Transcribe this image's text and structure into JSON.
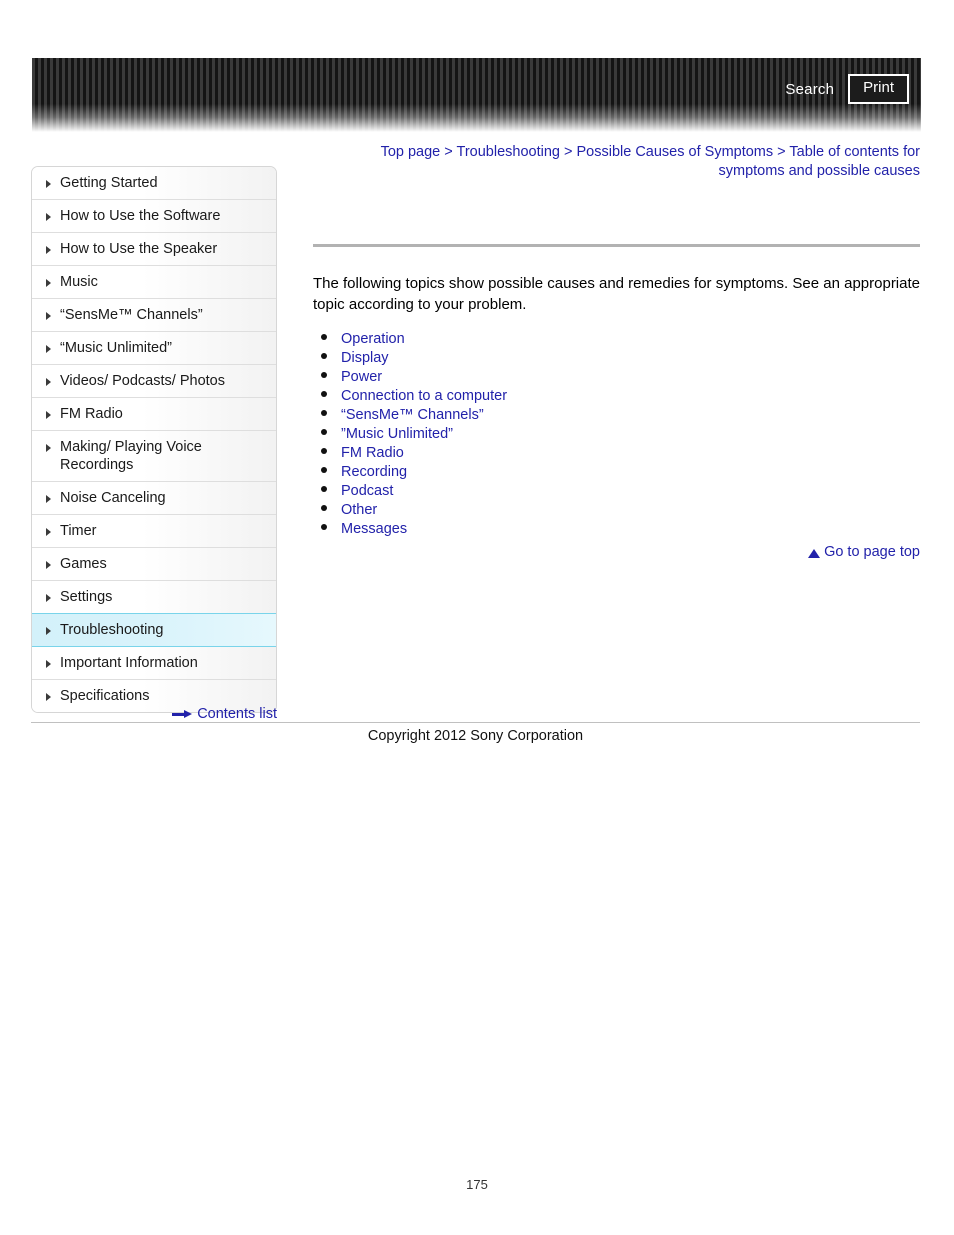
{
  "header": {
    "search_label": "Search",
    "print_label": "Print"
  },
  "breadcrumb": {
    "items": [
      "Top page",
      "Troubleshooting",
      "Possible Causes of Symptoms",
      "Table of contents for symptoms and possible causes"
    ],
    "separator": ">",
    "line1": "Top page > Troubleshooting > Possible Causes of Symptoms > Table of contents for symptoms",
    "line2": "and possible causes"
  },
  "sidebar": {
    "items": [
      {
        "label": "Getting Started",
        "active": false
      },
      {
        "label": "How to Use the Software",
        "active": false
      },
      {
        "label": "How to Use the Speaker",
        "active": false
      },
      {
        "label": "Music",
        "active": false
      },
      {
        "label": "“SensMe™ Channels”",
        "active": false
      },
      {
        "label": "“Music Unlimited”",
        "active": false
      },
      {
        "label": "Videos/ Podcasts/ Photos",
        "active": false
      },
      {
        "label": "FM Radio",
        "active": false
      },
      {
        "label": "Making/ Playing Voice Recordings",
        "active": false
      },
      {
        "label": "Noise Canceling",
        "active": false
      },
      {
        "label": "Timer",
        "active": false
      },
      {
        "label": "Games",
        "active": false
      },
      {
        "label": "Settings",
        "active": false
      },
      {
        "label": "Troubleshooting",
        "active": true
      },
      {
        "label": "Important Information",
        "active": false
      },
      {
        "label": "Specifications",
        "active": false
      }
    ],
    "contents_list_label": "Contents list"
  },
  "main": {
    "intro": "The following topics show possible causes and remedies for symptoms. See an appropriate topic according to your problem.",
    "topics": [
      "Operation",
      "Display",
      "Power",
      "Connection to a computer",
      "“SensMe™ Channels”",
      "”Music Unlimited”",
      "FM Radio",
      "Recording",
      "Podcast",
      "Other",
      "Messages"
    ],
    "go_to_page_top_label": "Go to page top"
  },
  "footer": {
    "copyright": "Copyright 2012 Sony Corporation",
    "page_number": "175"
  },
  "colors": {
    "link": "#2222aa",
    "active_sidebar_bg": "#d3f1fa",
    "active_sidebar_border": "#79d4ea",
    "rule": "#b2b2b2",
    "header_dark": "#141414"
  }
}
